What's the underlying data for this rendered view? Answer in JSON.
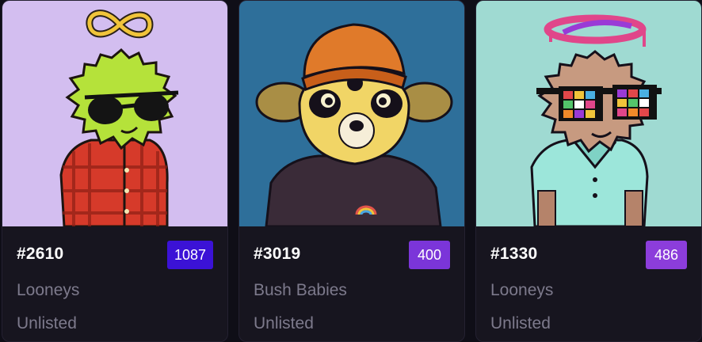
{
  "cards": [
    {
      "token_id": "#2610",
      "rank": "1087",
      "rank_color": "#3b12d6",
      "collection": "Looneys",
      "status": "Unlisted",
      "art_background": "#d3bef0",
      "art_icon": "green-looney-avatar"
    },
    {
      "token_id": "#3019",
      "rank": "400",
      "rank_color": "#7b35d9",
      "collection": "Bush Babies",
      "status": "Unlisted",
      "art_background": "#2e6f9a",
      "art_icon": "bush-baby-avatar"
    },
    {
      "token_id": "#1330",
      "rank": "486",
      "rank_color": "#8c3ddb",
      "collection": "Looneys",
      "status": "Unlisted",
      "art_background": "#9fdad2",
      "art_icon": "brown-looney-avatar"
    }
  ]
}
